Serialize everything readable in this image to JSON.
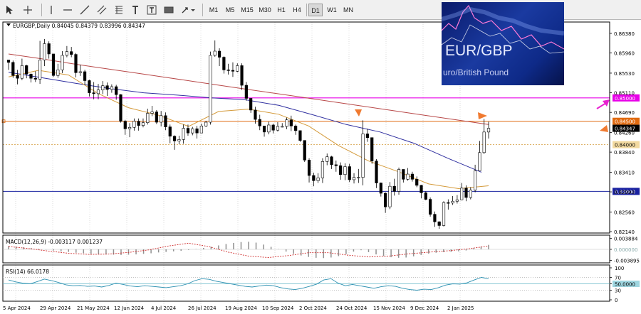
{
  "toolbar": {
    "timeframes": [
      "M1",
      "M5",
      "M15",
      "M30",
      "H1",
      "H4",
      "D1",
      "W1",
      "MN"
    ],
    "active_timeframe": "D1"
  },
  "thumbnail": {
    "title": "EUR/GBP",
    "subtitle": "uro/British Pound"
  },
  "chart_data": [
    {
      "type": "candlestick",
      "title": "EURGBP,Daily  0.84045 0.84379 0.83996 0.84347",
      "symbol": "EURGBP",
      "period": "Daily",
      "ohlc": {
        "open": 0.84045,
        "high": 0.84379,
        "low": 0.83996,
        "close": 0.84347
      },
      "ylim": [
        0.8195,
        0.8655
      ],
      "y_ticks": [
        0.8638,
        0.8596,
        0.8553,
        0.8511,
        0.8469,
        0.8426,
        0.8384,
        0.8341,
        0.8299,
        0.8256,
        0.8214
      ],
      "y_tick_labels": [
        "0.86380",
        "0.85960",
        "0.85530",
        "0.85110",
        "0.84690",
        "0.84260",
        "0.83840",
        "0.83410",
        "0.82990",
        "0.82560",
        "0.82140"
      ],
      "x_tick_labels": [
        "5 Apr 2024",
        "29 Apr 2024",
        "21 May 2024",
        "12 Jun 2024",
        "4 Jul 2024",
        "26 Jul 2024",
        "19 Aug 2024",
        "10 Sep 2024",
        "2 Oct 2024",
        "24 Oct 2024",
        "15 Nov 2024",
        "9 Dec 2024",
        "2 Jan 2025"
      ],
      "series": [
        {
          "name": "close",
          "values": [
            0.8576,
            0.8548,
            0.8542,
            0.8569,
            0.8551,
            0.8542,
            0.854,
            0.8581,
            0.8616,
            0.8594,
            0.8548,
            0.856,
            0.8591,
            0.8599,
            0.8593,
            0.8554,
            0.8556,
            0.8537,
            0.8511,
            0.8509,
            0.8517,
            0.8526,
            0.8518,
            0.8524,
            0.8507,
            0.845,
            0.8434,
            0.8437,
            0.845,
            0.8441,
            0.8447,
            0.8467,
            0.847,
            0.8448,
            0.8462,
            0.8438,
            0.8418,
            0.8408,
            0.8411,
            0.8435,
            0.8425,
            0.8434,
            0.8425,
            0.844,
            0.8448,
            0.8591,
            0.86,
            0.8587,
            0.856,
            0.8559,
            0.8557,
            0.8569,
            0.8527,
            0.8499,
            0.8474,
            0.8454,
            0.844,
            0.8427,
            0.8442,
            0.8431,
            0.8439,
            0.8439,
            0.8453,
            0.844,
            0.843,
            0.8409,
            0.8367,
            0.8334,
            0.8323,
            0.8329,
            0.8364,
            0.8374,
            0.8357,
            0.8355,
            0.8336,
            0.8353,
            0.8325,
            0.833,
            0.833,
            0.8423,
            0.8415,
            0.8365,
            0.8318,
            0.8296,
            0.8267,
            0.8311,
            0.83,
            0.8347,
            0.8326,
            0.8337,
            0.8326,
            0.8313,
            0.8297,
            0.8283,
            0.8251,
            0.8235,
            0.8227,
            0.8276,
            0.8275,
            0.8279,
            0.8282,
            0.8307,
            0.8287,
            0.8303,
            0.8344,
            0.8383,
            0.8427,
            0.8435
          ]
        },
        {
          "name": "high",
          "values": [
            0.8581,
            0.858,
            0.856,
            0.8584,
            0.8571,
            0.8552,
            0.8557,
            0.8622,
            0.8626,
            0.8621,
            0.8594,
            0.8573,
            0.86,
            0.8611,
            0.8609,
            0.8596,
            0.8571,
            0.856,
            0.8539,
            0.8534,
            0.853,
            0.8536,
            0.8533,
            0.8529,
            0.8528,
            0.8508,
            0.8453,
            0.8446,
            0.8456,
            0.8456,
            0.8456,
            0.8477,
            0.8483,
            0.8474,
            0.8472,
            0.8469,
            0.8443,
            0.842,
            0.8419,
            0.8443,
            0.8443,
            0.8438,
            0.844,
            0.8445,
            0.8451,
            0.8599,
            0.8623,
            0.8606,
            0.8589,
            0.8573,
            0.8576,
            0.8574,
            0.8574,
            0.8534,
            0.8498,
            0.8481,
            0.8464,
            0.844,
            0.8449,
            0.8445,
            0.8448,
            0.8446,
            0.8458,
            0.8462,
            0.8443,
            0.8429,
            0.8408,
            0.8371,
            0.834,
            0.8339,
            0.8371,
            0.8381,
            0.8376,
            0.8366,
            0.8362,
            0.836,
            0.8359,
            0.8339,
            0.8348,
            0.8452,
            0.8434,
            0.8415,
            0.8369,
            0.8319,
            0.8298,
            0.832,
            0.8327,
            0.8351,
            0.8347,
            0.835,
            0.8342,
            0.8332,
            0.8314,
            0.83,
            0.8287,
            0.8257,
            0.8236,
            0.8279,
            0.8283,
            0.829,
            0.8292,
            0.8318,
            0.8313,
            0.8309,
            0.8357,
            0.8408,
            0.8455,
            0.8449
          ]
        },
        {
          "name": "low",
          "values": [
            0.856,
            0.8543,
            0.8529,
            0.8538,
            0.8542,
            0.8533,
            0.8534,
            0.853,
            0.8568,
            0.8584,
            0.8545,
            0.8543,
            0.8553,
            0.8587,
            0.8587,
            0.8544,
            0.8547,
            0.8527,
            0.8503,
            0.8497,
            0.8497,
            0.8508,
            0.8504,
            0.8511,
            0.8496,
            0.8447,
            0.8421,
            0.8416,
            0.843,
            0.843,
            0.8437,
            0.8443,
            0.8461,
            0.8444,
            0.8439,
            0.8431,
            0.8403,
            0.8389,
            0.8401,
            0.8402,
            0.8419,
            0.842,
            0.8413,
            0.8425,
            0.8438,
            0.8443,
            0.8588,
            0.8568,
            0.8552,
            0.855,
            0.8545,
            0.8555,
            0.8517,
            0.8494,
            0.8468,
            0.8445,
            0.8431,
            0.8417,
            0.8422,
            0.8424,
            0.8428,
            0.8437,
            0.8433,
            0.8429,
            0.8421,
            0.8406,
            0.8363,
            0.8319,
            0.8311,
            0.8318,
            0.8318,
            0.8356,
            0.8348,
            0.8342,
            0.8325,
            0.8324,
            0.832,
            0.8317,
            0.8318,
            0.8313,
            0.8406,
            0.8359,
            0.8307,
            0.8289,
            0.8254,
            0.8262,
            0.8291,
            0.8293,
            0.8319,
            0.8323,
            0.8321,
            0.8309,
            0.8285,
            0.8281,
            0.8246,
            0.8224,
            0.822,
            0.8225,
            0.8261,
            0.8271,
            0.8274,
            0.8281,
            0.8279,
            0.8283,
            0.8298,
            0.8344,
            0.838,
            0.8413
          ]
        },
        {
          "name": "ma_red",
          "values": [
            0.8594,
            0.8584,
            0.8573,
            0.8563,
            0.8553,
            0.8543,
            0.8533,
            0.8523,
            0.8513,
            0.8503,
            0.8493,
            0.8483,
            0.8473,
            0.8463,
            0.8453,
            0.8443
          ]
        },
        {
          "name": "ma_blue",
          "values": [
            0.8555,
            0.8543,
            0.8531,
            0.852,
            0.8511,
            0.8506,
            0.85,
            0.8496,
            0.8484,
            0.8464,
            0.8443,
            0.8427,
            0.8403,
            0.8371,
            0.8341
          ]
        },
        {
          "name": "ma_orange",
          "values": [
            0.8545,
            0.8559,
            0.8549,
            0.8509,
            0.8479,
            0.8463,
            0.8439,
            0.8471,
            0.8476,
            0.8465,
            0.844,
            0.8398,
            0.8365,
            0.8342,
            0.8316,
            0.8306,
            0.8312
          ]
        }
      ],
      "price_labels": [
        "0.85000",
        "0.84500",
        "0.84347",
        "0.84000",
        "0.83000"
      ],
      "levels": [
        0.85,
        0.845,
        0.8435,
        0.84,
        0.83
      ],
      "colors": {
        "level_magenta": "#e800e8",
        "level_orange": "#e06a10",
        "level_blue": "#1a22a0",
        "candle": "#000000",
        "ma_red": "#b84848",
        "ma_blue": "#3030a0",
        "ma_orange": "#d49a3a",
        "arrow_orange": "#f07a30",
        "arrow_magenta": "#e820d0"
      }
    },
    {
      "type": "bar",
      "title": "MACD(12,26,9) -0.003117 0.001237",
      "ylim": [
        -0.0043,
        0.0043
      ],
      "y_ticks": [
        0.003884,
        0.0,
        -0.003895
      ],
      "y_tick_labels": [
        "0.003884",
        "0.000000",
        "-0.003895"
      ],
      "series": [
        {
          "name": "histogram",
          "values": [
            0.0012,
            0.001,
            0.0008,
            0.0005,
            0.0002,
            -0.0001,
            -0.0004,
            -0.0007,
            -0.0009,
            -0.0012,
            -0.0014,
            -0.0016,
            -0.0017,
            -0.0018,
            -0.0019,
            -0.002,
            -0.0019,
            -0.0018,
            -0.0016,
            -0.0014,
            -0.0011,
            -0.0009,
            -0.0007,
            -0.0005,
            -0.0002,
            0.0001,
            0.0005,
            0.0009,
            0.0014,
            0.0019,
            0.0023,
            0.0026,
            0.0027,
            0.0024,
            0.0017,
            0.0009,
            0.0001,
            -0.0008,
            -0.0016,
            -0.0022,
            -0.0027,
            -0.003,
            -0.0031,
            -0.0029,
            -0.0024,
            -0.0017,
            -0.0008,
            -0.0003,
            -0.001,
            -0.0018,
            -0.0024,
            -0.0028,
            -0.003,
            -0.0029,
            -0.0025,
            -0.002,
            -0.0015,
            -0.0012,
            -0.001,
            -0.0009,
            -0.0007,
            -0.0004,
            0.0004,
            0.001,
            0.0016
          ]
        },
        {
          "name": "signal",
          "values": [
            0.001,
            0.0003,
            -0.0006,
            -0.0014,
            -0.0018,
            -0.0017,
            -0.0011,
            -0.0002,
            0.0012,
            0.0022,
            0.001,
            -0.001,
            -0.0024,
            -0.0029,
            -0.0022,
            -0.0012,
            -0.0012,
            -0.0021,
            -0.0027,
            -0.0024,
            -0.0016,
            -0.001,
            -0.0005,
            0.0002,
            0.0012
          ]
        }
      ]
    },
    {
      "type": "line",
      "title": "RSI(14) 66.0178",
      "ylim": [
        0,
        100
      ],
      "y_ticks": [
        100,
        70,
        50,
        30,
        0
      ],
      "y_tick_labels": [
        "100",
        "70",
        "50.0000",
        "30",
        "0"
      ],
      "series": [
        {
          "name": "RSI",
          "values": [
            62,
            56,
            52,
            50,
            57,
            65,
            60,
            54,
            47,
            44,
            45,
            42,
            43,
            40,
            45,
            52,
            48,
            43,
            41,
            44,
            42,
            40,
            38,
            41,
            44,
            50,
            60,
            66,
            64,
            58,
            54,
            50,
            46,
            42,
            40,
            43,
            46,
            44,
            38,
            34,
            32,
            36,
            42,
            49,
            62,
            66,
            52,
            44,
            48,
            44,
            40,
            36,
            41,
            44,
            42,
            36,
            32,
            30,
            33,
            32,
            38,
            46,
            50,
            49,
            53,
            62,
            70,
            66
          ]
        }
      ]
    }
  ]
}
